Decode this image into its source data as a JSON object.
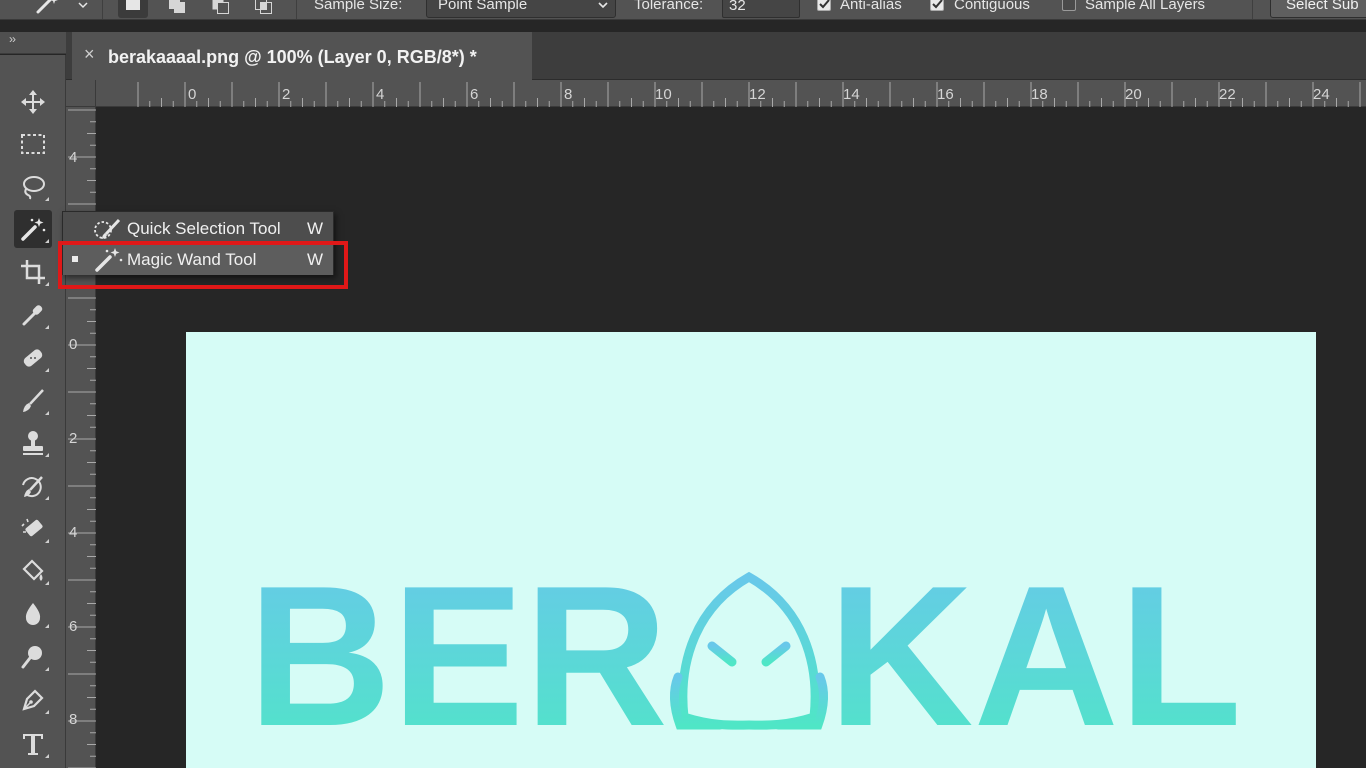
{
  "options_bar": {
    "sample_size_label": "Sample Size:",
    "sample_size_value": "Point Sample",
    "tolerance_label": "Tolerance:",
    "tolerance_value": "32",
    "anti_alias_label": "Anti-alias",
    "anti_alias_checked": true,
    "contiguous_label": "Contiguous",
    "contiguous_checked": true,
    "sample_all_layers_label": "Sample All Layers",
    "sample_all_layers_checked": false,
    "select_subject_label": "Select Sub"
  },
  "toolbar": {
    "collapse_label": "››",
    "tools": [
      "move-tool",
      "marquee-tool",
      "lasso-tool",
      "magic-wand-tool",
      "crop-tool",
      "eyedropper-tool",
      "healing-brush-tool",
      "brush-tool",
      "clone-stamp-tool",
      "history-brush-tool",
      "eraser-tool",
      "paint-bucket-tool",
      "blur-tool",
      "dodge-tool",
      "pen-tool",
      "type-tool"
    ],
    "active_tool": "magic-wand-tool"
  },
  "document_tab": {
    "close_glyph": "×",
    "title": "berakaaaal.png @ 100% (Layer 0, RGB/8*) *"
  },
  "rulers": {
    "horizontal": [
      "0",
      "2",
      "4",
      "6",
      "8",
      "10",
      "12",
      "14",
      "16",
      "18",
      "20",
      "22",
      "24"
    ],
    "vertical": [
      "4",
      "0",
      "2",
      "4",
      "6",
      "8"
    ]
  },
  "flyout": {
    "items": [
      {
        "label": "Quick Selection Tool",
        "shortcut": "W",
        "selected": false
      },
      {
        "label": "Magic Wand Tool",
        "shortcut": "W",
        "selected": true
      }
    ]
  },
  "canvas": {
    "background": "#d6fcf6",
    "logo_text_left": "BER",
    "logo_text_right": "KAL",
    "gradient_top": "#68c8ea",
    "gradient_bottom": "#4fe6c6"
  },
  "colors": {
    "highlight": "#e01818"
  }
}
